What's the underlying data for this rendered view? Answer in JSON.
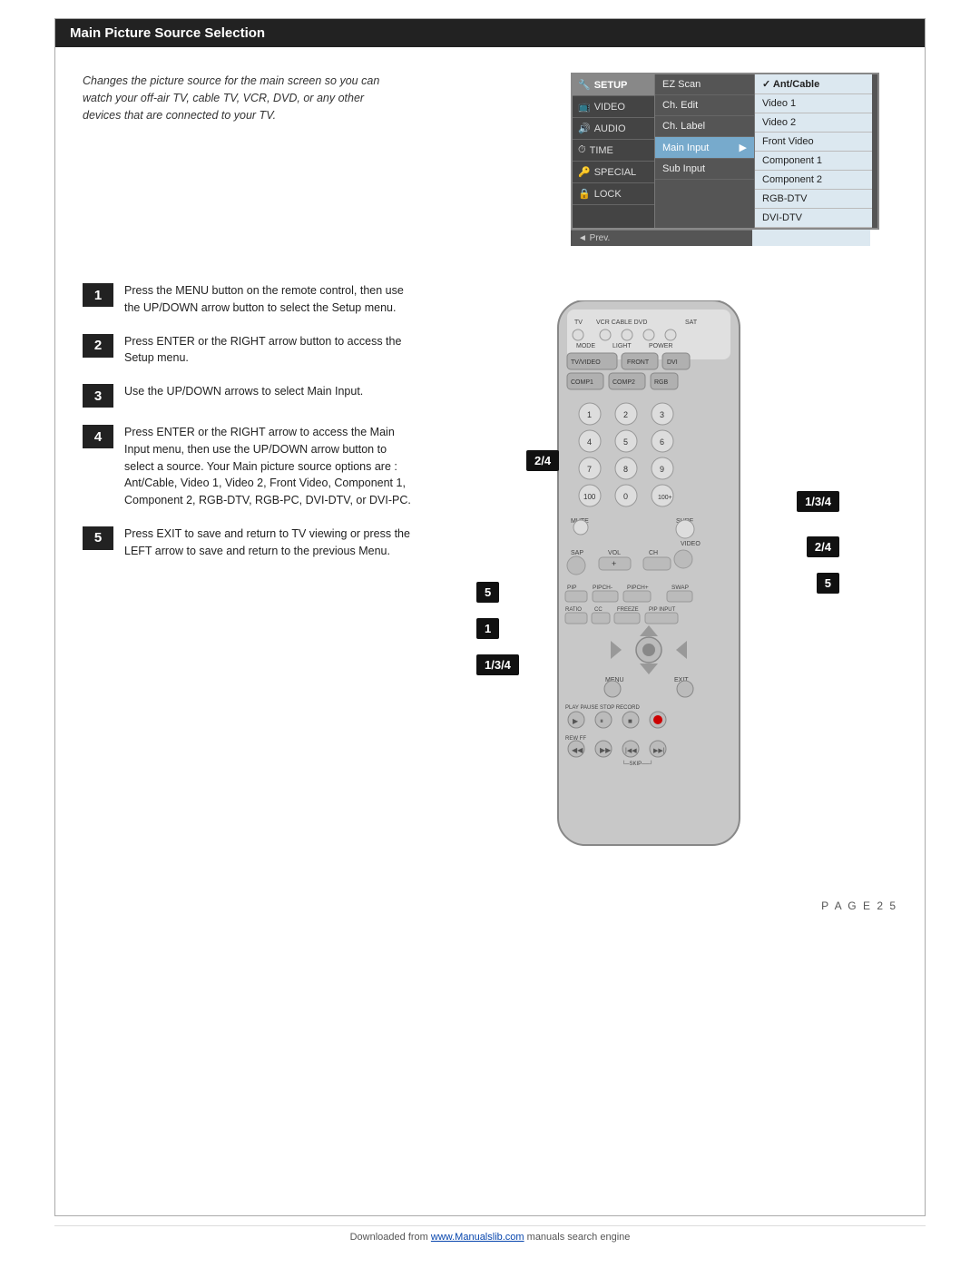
{
  "header": {
    "title": "Main Picture Source Selection"
  },
  "intro": {
    "text": "Changes the picture source for the main screen so you can watch your off-air TV, cable TV, VCR, DVD, or any other devices that are connected to your TV."
  },
  "osd": {
    "col1": [
      {
        "label": "SETUP",
        "icon": "wrench",
        "active": true
      },
      {
        "label": "VIDEO",
        "icon": "tv"
      },
      {
        "label": "AUDIO",
        "icon": "speaker"
      },
      {
        "label": "TIME",
        "icon": "clock"
      },
      {
        "label": "SPECIAL",
        "icon": "key"
      },
      {
        "label": "LOCK",
        "icon": "lock"
      }
    ],
    "col2": [
      {
        "label": "EZ Scan"
      },
      {
        "label": "Ch. Edit"
      },
      {
        "label": "Ch. Label"
      },
      {
        "label": "Main Input",
        "arrow": true,
        "highlighted": true
      },
      {
        "label": "Sub Input"
      }
    ],
    "col3": [
      {
        "label": "Ant/Cable",
        "checked": true
      },
      {
        "label": "Video 1"
      },
      {
        "label": "Video 2"
      },
      {
        "label": "Front Video"
      },
      {
        "label": "Component 1"
      },
      {
        "label": "Component 2"
      },
      {
        "label": "RGB-DTV"
      },
      {
        "label": "DVI-DTV"
      }
    ],
    "prev_label": "◄ Prev."
  },
  "steps": [
    {
      "num": "1",
      "text": "Press the MENU button on the remote control, then use the UP/DOWN arrow button to select the Setup menu."
    },
    {
      "num": "2",
      "text": "Press ENTER or the RIGHT arrow button to access the Setup menu."
    },
    {
      "num": "3",
      "text": "Use the UP/DOWN arrows to select Main Input."
    },
    {
      "num": "4",
      "text": "Press ENTER or the RIGHT arrow to access the Main Input menu, then use the UP/DOWN arrow button to select a source. Your Main picture source options are : Ant/Cable, Video 1, Video 2, Front Video, Component 1, Component 2, RGB-DTV, RGB-PC, DVI-DTV, or DVI-PC."
    },
    {
      "num": "5",
      "text": "Press EXIT to save and return to TV viewing or press the LEFT arrow to save and return to the previous Menu."
    }
  ],
  "callouts": [
    {
      "label": "1/3/4",
      "position": "right-top"
    },
    {
      "label": "2/4",
      "position": "right-mid"
    },
    {
      "label": "5",
      "position": "right-bot"
    },
    {
      "label": "5",
      "position": "left-top"
    },
    {
      "label": "1",
      "position": "left-mid"
    },
    {
      "label": "1/3/4",
      "position": "left-bot"
    },
    {
      "label": "2/4",
      "position": "left-remote"
    }
  ],
  "page": {
    "number": "P A G E  2 5"
  },
  "footer": {
    "text": "Downloaded from ",
    "link_text": "www.Manualslib.com",
    "link_href": "http://www.manualslib.com",
    "suffix": " manuals search engine"
  }
}
